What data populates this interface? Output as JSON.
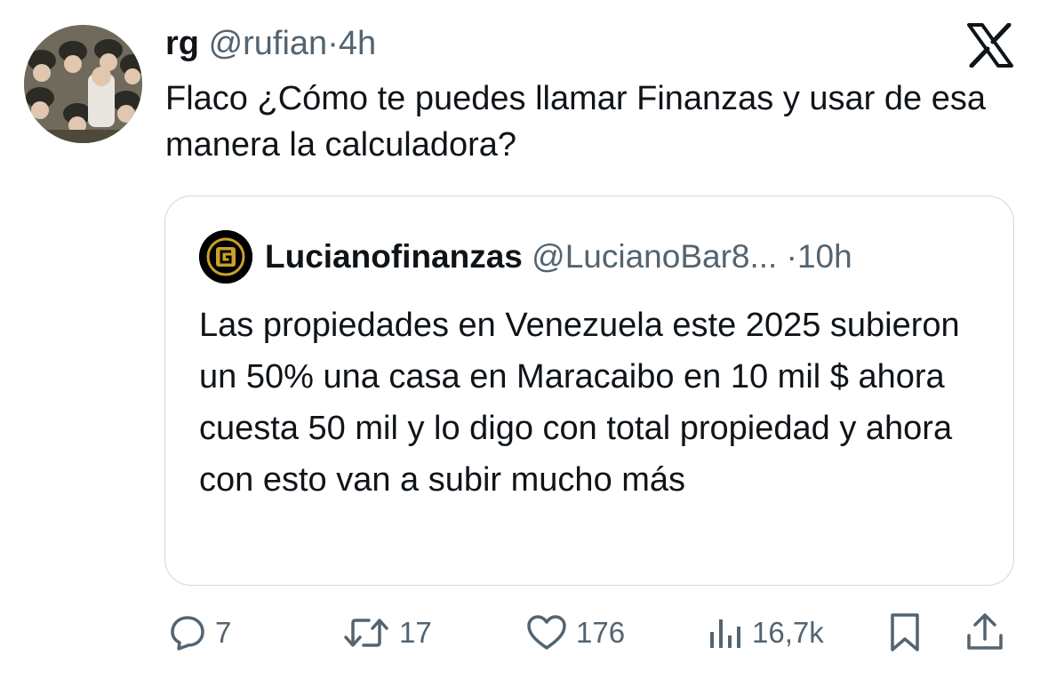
{
  "tweet": {
    "author": {
      "name": "rg",
      "handle": "@rufian",
      "separator": "·",
      "time": "4h"
    },
    "text": "Flaco ¿Cómo te puedes llamar Finanzas y usar de esa manera la calculadora?",
    "logo_icon": "x-logo-icon",
    "avatar_icon": "profile-photo"
  },
  "quote": {
    "author": {
      "name": "Lucianofinanzas",
      "handle": "@LucianoBar8...",
      "separator": "·",
      "time": "10h"
    },
    "text": "Las propiedades en Venezuela este 2025 subieron un 50% una casa en Maracaibo en 10 mil $ ahora cuesta 50 mil y lo digo con total propiedad y ahora con esto van a subir mucho más",
    "avatar_icon": "gold-g-logo"
  },
  "actions": {
    "replies": "7",
    "retweets": "17",
    "likes": "176",
    "views": "16,7k"
  },
  "colors": {
    "text": "#0f1419",
    "secondary": "#536471",
    "border": "#cfd9de",
    "gold": "#c9a227"
  }
}
